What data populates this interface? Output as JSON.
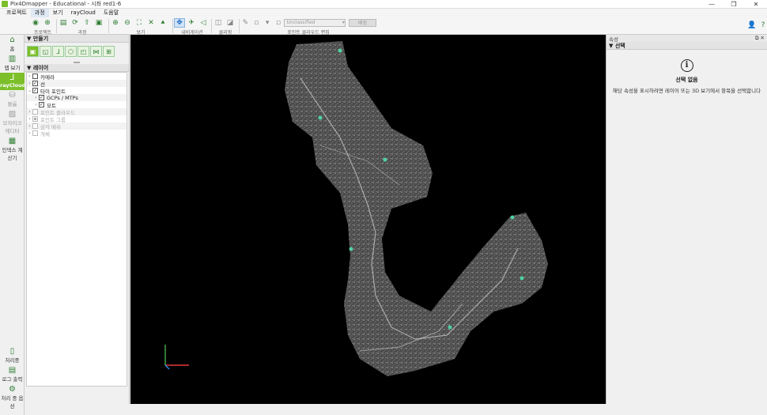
{
  "titlebar": {
    "title": "Pix4Dmapper - Educational - 시좌 red1-6",
    "minimize": "—",
    "maximize": "❐",
    "close": "✕"
  },
  "menu": [
    "프로젝트",
    "과정",
    "보기",
    "rayCloud",
    "도움말"
  ],
  "toolbar": {
    "group_labels": {
      "project": "프로젝트",
      "process": "과정",
      "view": "보기",
      "navigation": "내비게이션",
      "clipping": "클리핑",
      "point_cloud_edit": "포인트 클라우드 편집"
    },
    "class_dropdown": "Unclassified",
    "apply_button": "배정"
  },
  "leftnav": {
    "top": [
      {
        "label": "홈",
        "icon": "home-icon"
      },
      {
        "label": "맵 보기",
        "icon": "map-icon"
      },
      {
        "label": "rayCloud",
        "icon": "raycloud-icon",
        "active": true
      },
      {
        "label": "볼륨",
        "icon": "volume-icon",
        "gray": true
      },
      {
        "label": "모자이크 에디터",
        "icon": "mosaic-icon",
        "gray": true
      },
      {
        "label": "인덱스 계산기",
        "icon": "index-icon"
      }
    ],
    "bottom": [
      {
        "label": "처리중",
        "icon": "processing-icon"
      },
      {
        "label": "로그 출력",
        "icon": "log-icon"
      },
      {
        "label": "처리 중 옵션",
        "icon": "gear-icon"
      }
    ]
  },
  "create_panel": {
    "title": "만들기"
  },
  "layers_panel": {
    "title": "레이어",
    "items": [
      {
        "label": "카메라",
        "checked": false,
        "indent": 0,
        "dim": false
      },
      {
        "label": "선",
        "checked": true,
        "indent": 0,
        "dim": false
      },
      {
        "label": "타이 포인트",
        "checked": true,
        "indent": 0,
        "dim": false,
        "expanded": true
      },
      {
        "label": "GCPs / MTPs",
        "checked": true,
        "indent": 1,
        "dim": false
      },
      {
        "label": "모트",
        "checked": true,
        "indent": 1,
        "dim": false
      },
      {
        "label": "포인트 클라우드",
        "checked": false,
        "indent": 0,
        "dim": true
      },
      {
        "label": "포인트 그룹",
        "checked": false,
        "indent": 0,
        "dim": true
      },
      {
        "label": "삼각 메쉬",
        "checked": false,
        "indent": 0,
        "dim": true
      },
      {
        "label": "개체",
        "checked": false,
        "indent": 0,
        "dim": true
      }
    ]
  },
  "properties_panel": {
    "title": "속성",
    "section": "선택",
    "no_selection_title": "선택 없음",
    "no_selection_desc": "해당 속성을 표시하려면 레이어 또는 3D 보기에서 항목을 선택합니다"
  },
  "colors": {
    "accent": "#7cbf2b",
    "viewport_bg": "#000000",
    "axis_x": "#e53935",
    "axis_y": "#43a047",
    "axis_z": "#1e88e5"
  }
}
